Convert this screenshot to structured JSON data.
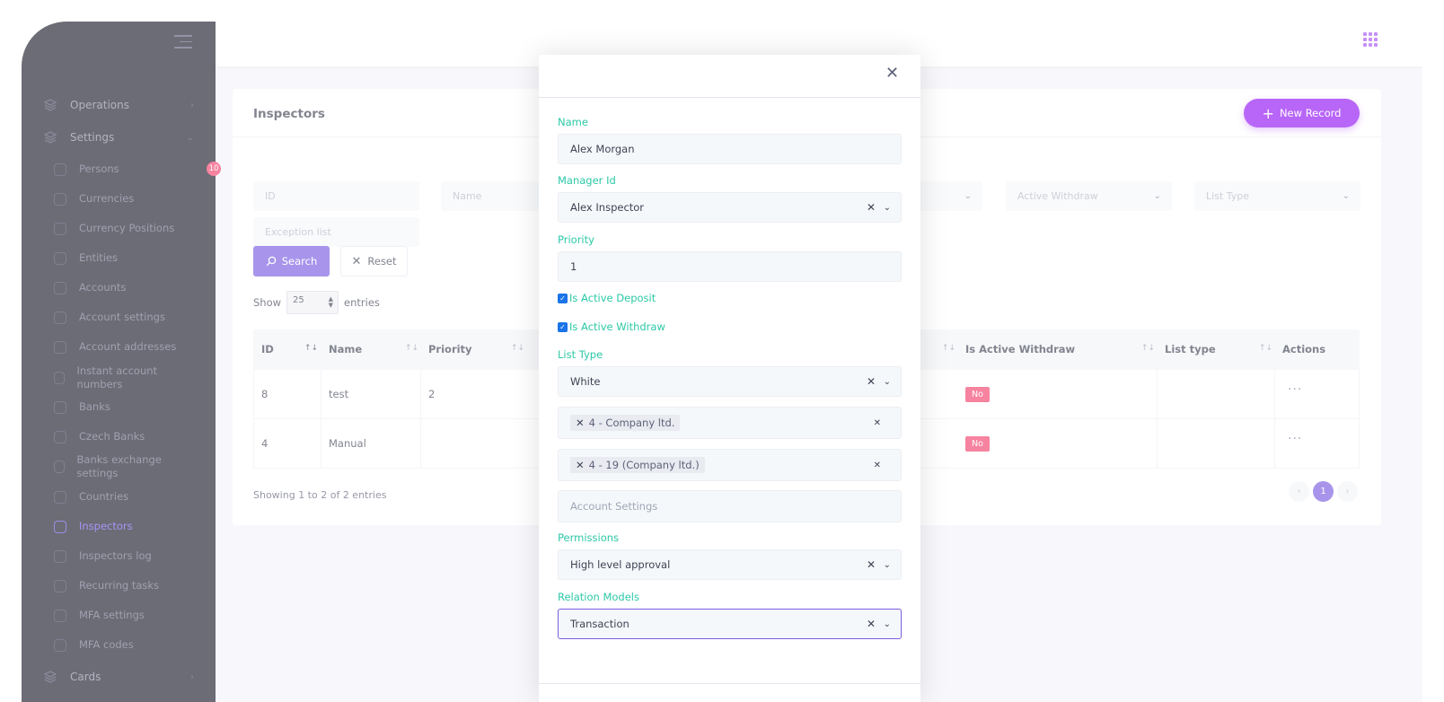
{
  "sidebar": {
    "groups": [
      {
        "label": "Operations"
      },
      {
        "label": "Settings"
      },
      {
        "label": "Cards"
      }
    ],
    "items": [
      {
        "label": "Persons",
        "badge": "10"
      },
      {
        "label": "Currencies"
      },
      {
        "label": "Currency Positions"
      },
      {
        "label": "Entities"
      },
      {
        "label": "Accounts"
      },
      {
        "label": "Account settings"
      },
      {
        "label": "Account addresses"
      },
      {
        "label": "Instant account numbers"
      },
      {
        "label": "Banks"
      },
      {
        "label": "Czech Banks"
      },
      {
        "label": "Banks exchange settings"
      },
      {
        "label": "Countries"
      },
      {
        "label": "Inspectors"
      },
      {
        "label": "Inspectors log"
      },
      {
        "label": "Recurring tasks"
      },
      {
        "label": "MFA settings"
      },
      {
        "label": "MFA codes"
      }
    ]
  },
  "page": {
    "title": "Inspectors",
    "new_record_label": "New Record"
  },
  "filters": {
    "id_placeholder": "ID",
    "name_placeholder": "Name",
    "active_withdraw_placeholder": "Active Withdraw",
    "list_type_placeholder": "List Type",
    "exception_list_placeholder": "Exception list",
    "search_label": "Search",
    "reset_label": "Reset"
  },
  "show_entries": {
    "show": "Show",
    "value": "25",
    "entries": "entries"
  },
  "table": {
    "headers": {
      "id": "ID",
      "name": "Name",
      "priority": "Priority",
      "is_active_withdraw": "Is Active Withdraw",
      "list_type": "List type",
      "actions": "Actions"
    },
    "rows": [
      {
        "id": "8",
        "name": "test",
        "priority": "2",
        "withdraw": "No"
      },
      {
        "id": "4",
        "name": "Manual",
        "priority": "",
        "withdraw": "No"
      }
    ],
    "showing": "Showing 1 to 2 of 2 entries",
    "current_page": "1"
  },
  "modal": {
    "name_label": "Name",
    "name_value": "Alex Morgan",
    "manager_label": "Manager Id",
    "manager_value": "Alex Inspector",
    "priority_label": "Priority",
    "priority_value": "1",
    "active_deposit_label": "Is Active Deposit",
    "active_withdraw_label": "Is Active Withdraw",
    "list_type_label": "List Type",
    "list_type_value": "White",
    "tag_company": "4 - Company ltd.",
    "tag_company_account": "4 - 19 (Company ltd.)",
    "account_settings_placeholder": "Account Settings",
    "permissions_label": "Permissions",
    "permissions_value": "High level approval",
    "relation_label": "Relation Models",
    "relation_value": "Transaction"
  },
  "colors": {
    "accent": "#7a5de0",
    "brand_button": "#9315f3",
    "label_teal": "#2cc8a7",
    "danger": "#f1416c",
    "sidebar_bg": "#1e1e2d"
  }
}
